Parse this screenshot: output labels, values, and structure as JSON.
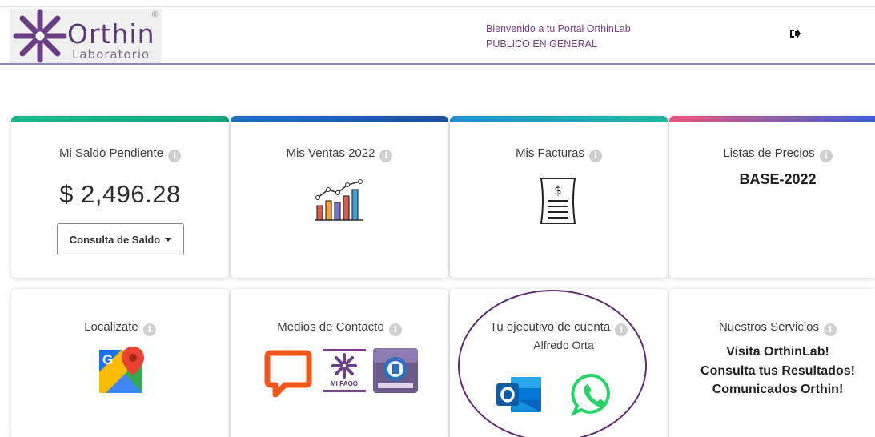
{
  "header": {
    "logo_word": "Orthin",
    "logo_sub": "Laboratorio",
    "logo_mark": "®",
    "welcome_line": "Bienvenido a tu Portal OrthinLab",
    "client_name": "PUBLICO EN GENERAL",
    "logout_icon": "sign-out-icon"
  },
  "cards": {
    "saldo": {
      "title": "Mi Saldo Pendiente",
      "amount": "$ 2,496.28",
      "button_label": "Consulta de Saldo"
    },
    "ventas": {
      "title": "Mis Ventas 2022",
      "icon": "growth-chart-icon"
    },
    "facturas": {
      "title": "Mis Facturas",
      "icon": "invoice-icon"
    },
    "precios": {
      "title": "Listas de Precios",
      "price_list": "BASE-2022"
    },
    "localizate": {
      "title": "Localizate",
      "icon": "google-maps-icon"
    },
    "contacto": {
      "title": "Medios de Contacto",
      "icons": [
        "chat-icon",
        "mi-pago-icon",
        "app-icon"
      ],
      "mi_pago_label": "MI PAGO"
    },
    "ejecutivo": {
      "title": "Tu ejecutivo de cuenta",
      "name": "Alfredo Orta",
      "icons": [
        "outlook-icon",
        "whatsapp-icon"
      ]
    },
    "servicios": {
      "title": "Nuestros Servicios",
      "lines": [
        "Visita OrthinLab!",
        "Consulta tus Resultados!",
        "Comunicados Orthin!"
      ]
    }
  },
  "info_glyph": "i",
  "colors": {
    "bar_1": "#1db58a",
    "bar_2": "#1f6fc5",
    "bar_3": "#22b5a0",
    "bar_4": "#e8557a",
    "brand_purple": "#7b3f8a",
    "highlight": "#5d2a6e"
  }
}
